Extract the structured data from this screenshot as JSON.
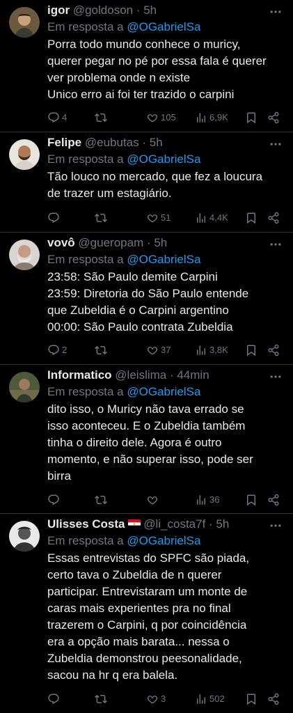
{
  "replies": [
    {
      "name": "igor",
      "handle": "@goldoson",
      "time": "· 5h",
      "in_reply_prefix": "Em resposta a",
      "in_reply_mention": "@OGabrielSa",
      "lines": [
        "Porra todo mundo conhece o muricy,",
        "querer pegar no pé por essa fala é querer",
        "ver problema onde n existe",
        "Unico erro ai foi ter trazido o carpini"
      ],
      "replies_count": "4",
      "retweets": "",
      "likes": "105",
      "views": "6,9K"
    },
    {
      "name": "Felipe",
      "handle": "@eubutas",
      "time": "· 5h",
      "in_reply_prefix": "Em resposta a",
      "in_reply_mention": "@OGabrielSa",
      "lines": [
        "Tão louco no mercado, que fez a loucura",
        "de trazer um estagiário."
      ],
      "replies_count": "",
      "retweets": "",
      "likes": "51",
      "views": "4,4K"
    },
    {
      "name": "vovô",
      "handle": "@gueropam",
      "time": "· 5h",
      "in_reply_prefix": "Em resposta a",
      "in_reply_mention": "@OGabrielSa",
      "lines": [
        "23:58: São Paulo demite Carpini",
        "23:59: Diretoria do São Paulo entende",
        "que Zubeldia é o Carpini argentino",
        "00:00: São Paulo contrata Zubeldia"
      ],
      "replies_count": "2",
      "retweets": "",
      "likes": "37",
      "views": "3,8K"
    },
    {
      "name": "Informatico",
      "handle": "@leislima",
      "time": "· 44min",
      "in_reply_prefix": "Em resposta a",
      "in_reply_mention": "@OGabrielSa",
      "lines": [
        "dito isso, o Muricy não tava errado se",
        "isso aconteceu. E o Zubeldia também",
        "tinha o direito dele. Agora é outro",
        "momento, e não superar isso, pode ser",
        "birra"
      ],
      "replies_count": "",
      "retweets": "",
      "likes": "",
      "views": "36"
    },
    {
      "name": "Ulisses Costa",
      "handle": "@li_costa7f",
      "time": "· 5h",
      "in_reply_prefix": "Em resposta a",
      "in_reply_mention": "@OGabrielSa",
      "lines": [
        "Essas entrevistas do SPFC são piada,",
        "certo tava o Zubeldia de n querer",
        "participar. Entrevistaram um monte de",
        "caras mais experientes pra no final",
        "trazerem o Carpini, q por coincidência",
        "era a opção mais barata... nessa o",
        "Zubeldia demonstrou peesonalidade,",
        "sacou na hr q era balela."
      ],
      "replies_count": "",
      "retweets": "",
      "likes": "3",
      "views": "502"
    }
  ],
  "icons": {
    "more": "more-dots-icon",
    "reply": "reply-bubble-icon",
    "retweet": "retweet-icon",
    "like": "heart-icon",
    "views": "views-bar-icon",
    "bookmark": "bookmark-icon",
    "share": "share-icon",
    "flag": "egypt-flag-icon"
  },
  "colors": {
    "background": "#000000",
    "text": "#e7e9ea",
    "muted": "#71767b",
    "link": "#1d9bf0",
    "divider": "#2f3336"
  }
}
